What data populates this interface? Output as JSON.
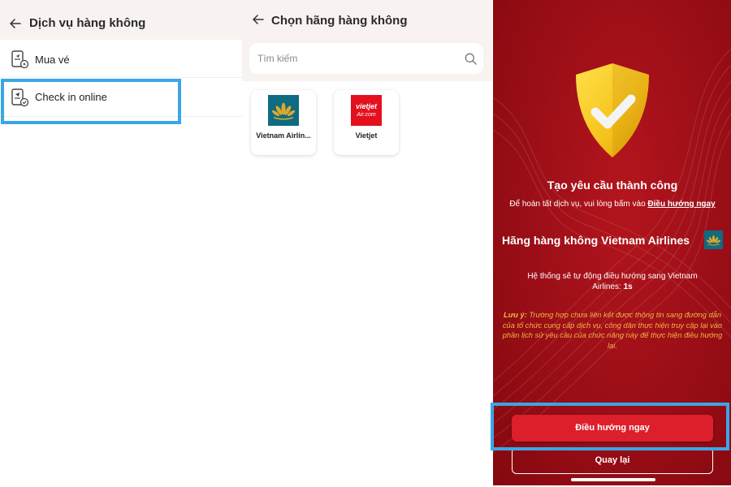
{
  "panel1": {
    "title": "Dịch vụ hàng không",
    "items": [
      {
        "label": "Mua vé",
        "icon": "phone-ticket-icon"
      },
      {
        "label": "Check in online",
        "icon": "phone-checkin-icon"
      }
    ]
  },
  "panel2": {
    "title": "Chọn hãng hàng không",
    "search": {
      "placeholder": "Tìm kiếm",
      "value": ""
    },
    "airlines": [
      {
        "name": "Vietnam Airlin...",
        "logo": "vietnam-airlines-logo"
      },
      {
        "name": "Vietjet",
        "logo": "vietjet-logo",
        "logo_text": "vietjetAir.com"
      }
    ]
  },
  "panel3": {
    "success_title": "Tạo yêu cầu thành công",
    "description_prefix": "Để hoàn tất dịch vụ, vui lòng bấm vào ",
    "description_link": "Điều hướng ngay",
    "airline_line": "Hãng hàng không Vietnam Airlines",
    "auto_redirect_prefix": "Hệ thống sẽ tự động điều hướng sang Vietnam Airlines: ",
    "countdown": "1s",
    "note_label": "Lưu ý:",
    "note_text": " Trường hợp chưa liên kết được thông tin sang đường dẫn của tổ chức cung cấp dịch vụ, công dân thực hiện truy cập lại vào phần lịch sử yêu cầu của chức năng này để thực hiện điều hướng lại.",
    "primary_button": "Điều hướng ngay",
    "secondary_button": "Quay lại"
  },
  "colors": {
    "brand_red": "#dc1f2b",
    "highlight_blue": "#3ba6e6",
    "note_yellow": "#f0b73f",
    "vna_teal": "#0e6b80",
    "vna_gold": "#e0a92a"
  }
}
